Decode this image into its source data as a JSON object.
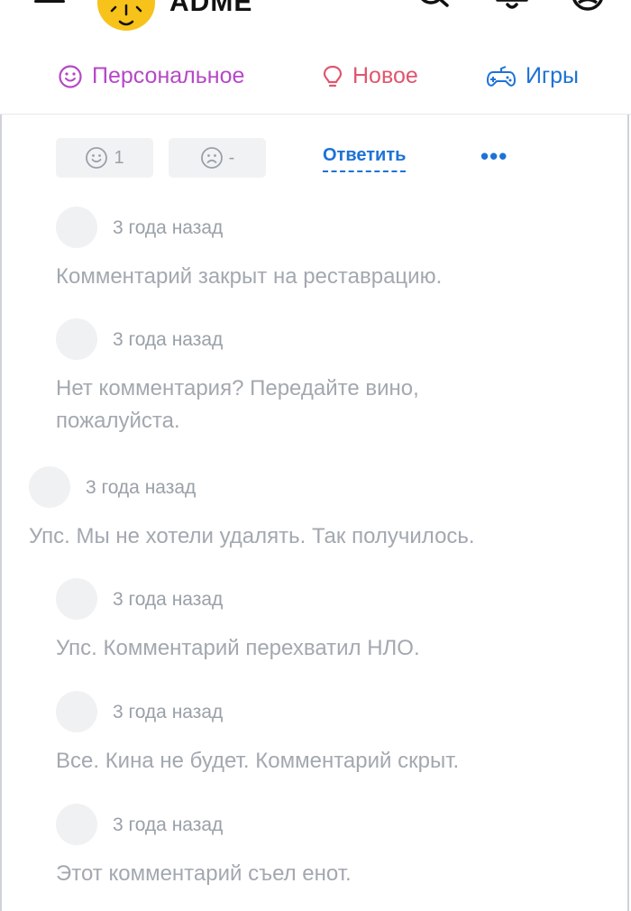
{
  "header": {
    "logo_text": "ADME",
    "icons": [
      "menu-icon",
      "lightbulb-logo-icon",
      "search-icon",
      "bell-icon",
      "user-icon"
    ]
  },
  "nav": {
    "items": [
      {
        "label": "Персональное",
        "icon": "smiley-icon",
        "color": "#b548c6"
      },
      {
        "label": "Новое",
        "icon": "lightbulb-icon",
        "color": "#e0566d"
      },
      {
        "label": "Игры",
        "icon": "gamepad-icon",
        "color": "#1d72d6"
      }
    ]
  },
  "clipped_text": "..., ...,...,...,. ,,,,",
  "reactions": {
    "like_count": "1",
    "dislike_count": "-",
    "reply_label": "Ответить",
    "more_label": "•••"
  },
  "comments": [
    {
      "time": "3 года назад",
      "text": "Комментарий закрыт на реставрацию."
    },
    {
      "time": "3 года назад",
      "text": "Нет комментария? Передайте вино, пожалуйста."
    },
    {
      "time": "3 года назад",
      "text": "Упс. Мы не хотели удалять. Так получилось."
    },
    {
      "time": "3 года назад",
      "text": "Упс. Комментарий перехватил НЛО."
    },
    {
      "time": "3 года назад",
      "text": "Все. Кина не будет. Комментарий скрыт."
    },
    {
      "time": "3 года назад",
      "text": "Этот комментарий съел енот."
    }
  ],
  "colors": {
    "accent": "#1d72d6",
    "personal": "#b548c6",
    "new": "#e0566d",
    "logo": "#f7c21a",
    "muted_text": "#a3a8b0"
  }
}
